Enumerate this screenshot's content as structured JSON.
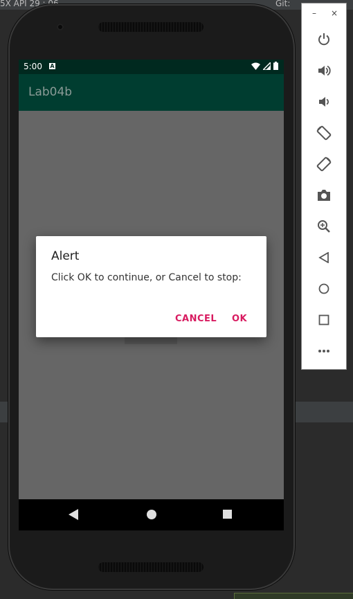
{
  "ide": {
    "title_fragment": "5X API 29 : 06",
    "git_label": "Git:"
  },
  "phone": {
    "status_bar": {
      "time": "5:00",
      "notification_letter": "A"
    },
    "app_bar": {
      "title": "Lab04b"
    },
    "dialog": {
      "title": "Alert",
      "message": "Click OK to continue, or Cancel to stop:",
      "cancel_label": "CANCEL",
      "ok_label": "OK"
    },
    "nav_bar": {
      "back_icon": "back-triangle-icon",
      "home_icon": "home-circle-icon",
      "recents_icon": "recents-square-icon"
    }
  },
  "emulator_panel": {
    "minimize_label": "–",
    "close_label": "×",
    "buttons": [
      {
        "icon": "power-icon"
      },
      {
        "icon": "volume-up-icon"
      },
      {
        "icon": "volume-down-icon"
      },
      {
        "icon": "rotate-left-icon"
      },
      {
        "icon": "rotate-right-icon"
      },
      {
        "icon": "camera-icon"
      },
      {
        "icon": "zoom-icon"
      },
      {
        "icon": "back-icon"
      },
      {
        "icon": "home-icon"
      },
      {
        "icon": "overview-icon"
      },
      {
        "icon": "more-icon"
      }
    ]
  },
  "colors": {
    "status_bar": "#00291f",
    "app_bar": "#003d30",
    "dialog_button": "#d81b60",
    "scrim": "#666666"
  }
}
